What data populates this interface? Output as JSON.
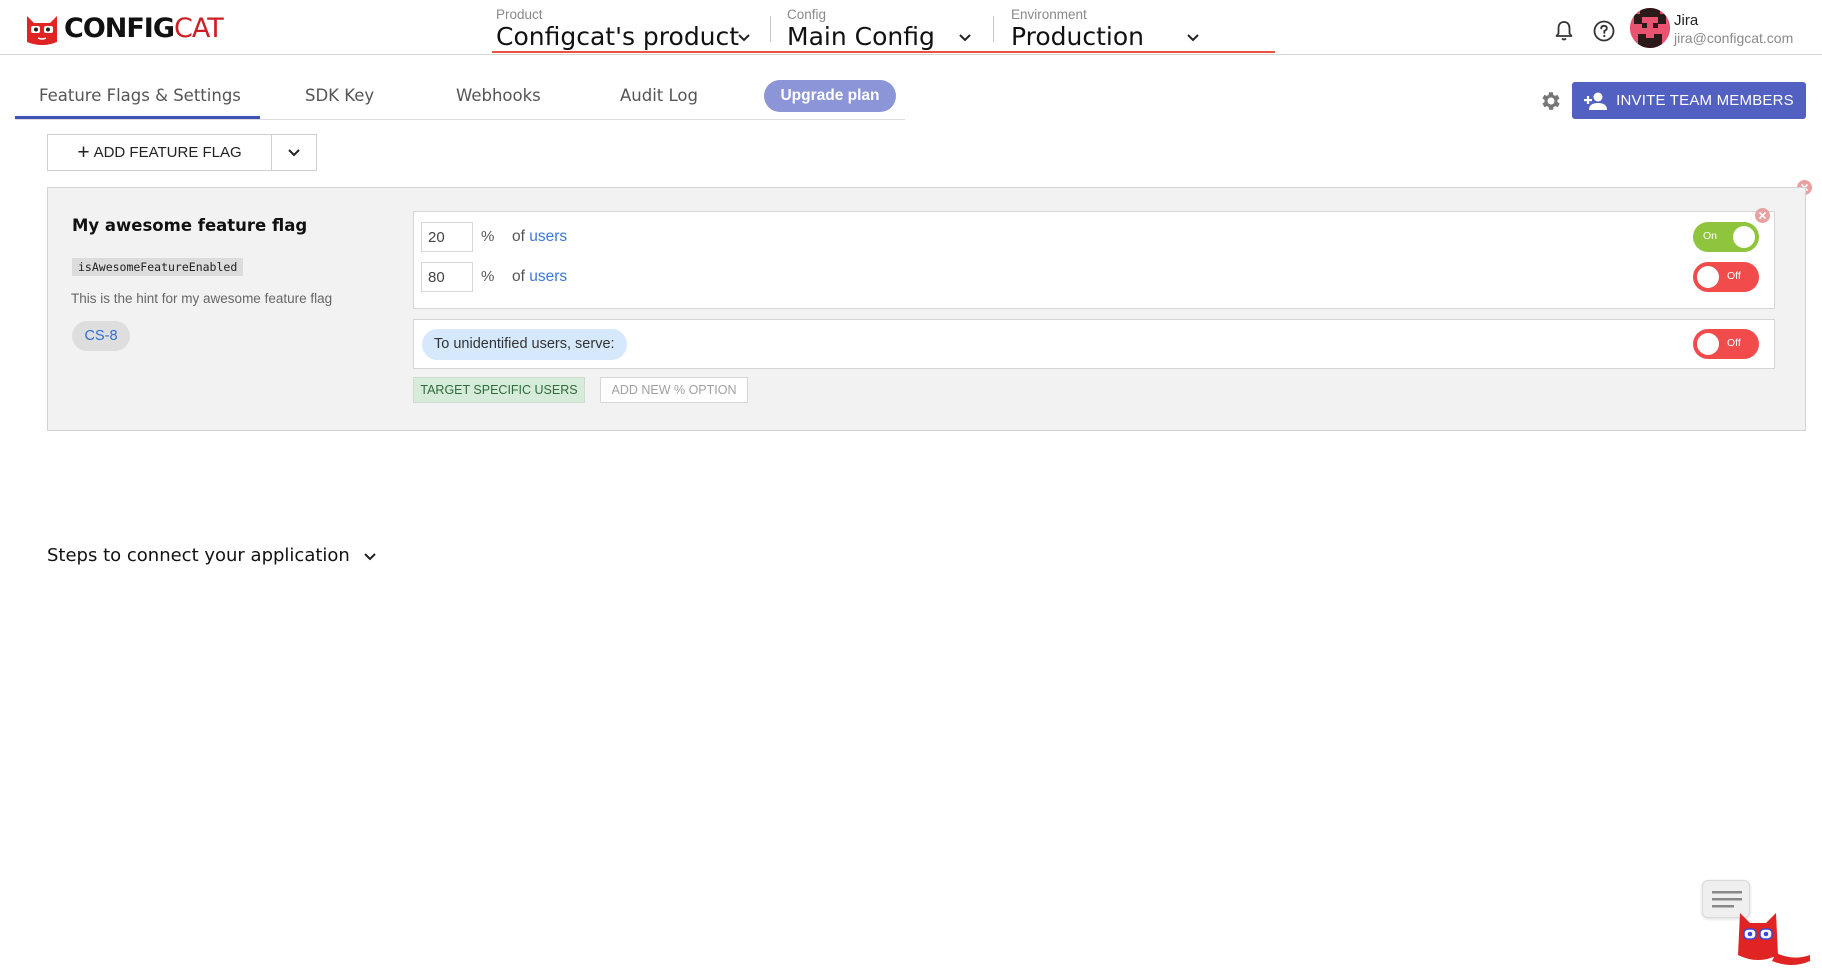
{
  "brand": {
    "logo_bold": "CONFIG",
    "logo_light": "CAT"
  },
  "header": {
    "product": {
      "label": "Product",
      "value": "Configcat's product"
    },
    "config": {
      "label": "Config",
      "value": "Main Config"
    },
    "environment": {
      "label": "Environment",
      "value": "Production"
    },
    "user": {
      "name": "Jira",
      "email": "jira@configcat.com"
    },
    "icons": [
      "bell-icon",
      "help-icon"
    ]
  },
  "tabs": [
    {
      "label": "Feature Flags & Settings",
      "active": true
    },
    {
      "label": "SDK Key",
      "active": false
    },
    {
      "label": "Webhooks",
      "active": false
    },
    {
      "label": "Audit Log",
      "active": false
    }
  ],
  "upgrade_label": "Upgrade plan",
  "invite_label": "INVITE TEAM MEMBERS",
  "add_flag_label": "ADD FEATURE FLAG",
  "flag": {
    "name": "My awesome feature flag",
    "key": "isAwesomeFeatureEnabled",
    "hint": "This is the hint for my awesome feature flag",
    "tag": "CS-8",
    "percentage_rules": [
      {
        "percent": "20",
        "sign": "%",
        "of_label": "of",
        "link_label": "users",
        "toggle": "On"
      },
      {
        "percent": "80",
        "sign": "%",
        "of_label": "of",
        "link_label": "users",
        "toggle": "Off"
      }
    ],
    "serve_label": "To unidentified users, serve:",
    "serve_toggle": "Off",
    "target_label": "TARGET SPECIFIC USERS",
    "add_option_label": "ADD NEW % OPTION"
  },
  "steps_label": "Steps to connect your application",
  "colors": {
    "primary": "#5160c1",
    "accent_underline": "#e8553f",
    "toggle_on": "#8fc53c",
    "toggle_off": "#f24b4b",
    "link": "#3c78d8",
    "brand_red": "#cc1f23"
  }
}
